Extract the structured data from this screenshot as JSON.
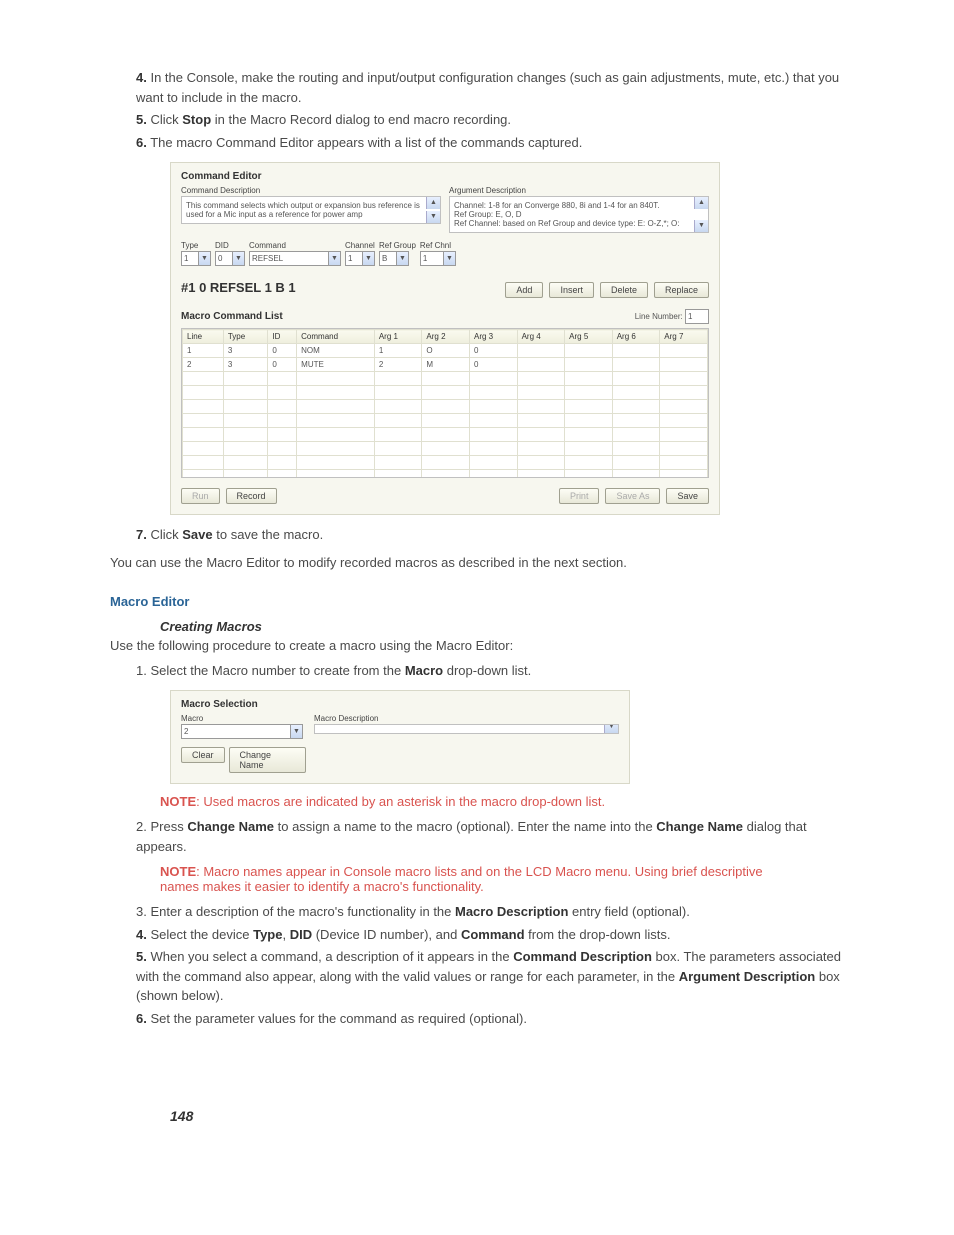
{
  "steps_top": {
    "s4": {
      "n": "4.",
      "text_a": "In the Console, make the routing and input/output configuration changes (such as gain adjustments, mute, etc.) that you want to include in the macro."
    },
    "s5": {
      "n": "5.",
      "pre": "Click ",
      "b": "Stop",
      "post": " in the Macro Record dialog to end macro recording."
    },
    "s6": {
      "n": "6.",
      "text": "The macro Command Editor appears with a list of the commands captured."
    }
  },
  "cmd_editor": {
    "title": "Command Editor",
    "cmd_desc_label": "Command Description",
    "arg_desc_label": "Argument Description",
    "cmd_desc_text": "This command selects which output or expansion bus reference is used for a Mic input as a reference for power amp",
    "arg_desc_text": "Channel: 1-8 for an Converge 880, 8i and 1-4 for an 840T.\nRef Group: E, O, D\nRef Channel: based on Ref Group and device type: E: O-Z,*; O:",
    "fields": {
      "type_label": "Type",
      "type_val": "1",
      "did_label": "DID",
      "did_val": "0",
      "command_label": "Command",
      "command_val": "REFSEL",
      "channel_label": "Channel",
      "channel_val": "1",
      "refgroup_label": "Ref Group",
      "refgroup_val": "B",
      "refchnl_label": "Ref Chnl",
      "refchnl_val": "1"
    },
    "big": "#1 0 REFSEL 1 B 1",
    "btn_add": "Add",
    "btn_insert": "Insert",
    "btn_delete": "Delete",
    "btn_replace": "Replace",
    "mcl_title": "Macro Command List",
    "line_number_label": "Line Number:",
    "line_number_val": "1",
    "cols": [
      "Line",
      "Type",
      "ID",
      "Command",
      "Arg 1",
      "Arg 2",
      "Arg 3",
      "Arg 4",
      "Arg 5",
      "Arg 6",
      "Arg 7"
    ],
    "rows": [
      [
        "1",
        "3",
        "0",
        "NOM",
        "1",
        "O",
        "0",
        "",
        "",
        "",
        ""
      ],
      [
        "2",
        "3",
        "0",
        "MUTE",
        "2",
        "M",
        "0",
        "",
        "",
        "",
        ""
      ]
    ],
    "btn_run": "Run",
    "btn_record": "Record",
    "btn_print": "Print",
    "btn_saveas": "Save As",
    "btn_save": "Save"
  },
  "step7": {
    "n": "7.",
    "pre": "Click ",
    "b": "Save",
    "post": " to save the macro."
  },
  "after7": "You can use the Macro Editor to modify recorded macros as described in the next section.",
  "section_heading": "Macro Editor",
  "subsection_heading": "Creating Macros",
  "intro_create": "Use the following procedure to create a macro using the Macro Editor:",
  "create_steps": {
    "s1": {
      "n": "1.",
      "pre": "Select the Macro number to create from the ",
      "b": "Macro",
      "post": " drop-down list."
    },
    "s2": {
      "n": "2.",
      "pre": "Press ",
      "b1": "Change Name",
      "mid": " to assign a name to the macro (optional). Enter the name into the ",
      "b2": "Change Name",
      "post": " dialog that appears."
    },
    "s3": {
      "n": "3.",
      "pre": "Enter a description of the macro's functionality in the ",
      "b": "Macro Description",
      "post": " entry field (optional)."
    },
    "s4": {
      "n": "4.",
      "pre": "Select the device ",
      "b1": "Type",
      "mid1": ", ",
      "b2": "DID",
      "mid2": " (Device ID number), and ",
      "b3": "Command",
      "post": " from the drop-down lists."
    },
    "s5": {
      "n": "5.",
      "pre": "When you select a command, a description of it appears in the ",
      "b1": "Command Description",
      "mid": " box. The parameters associated with the command also appear, along with the valid values or range for each parameter, in the ",
      "b2": "Argument Description",
      "post": " box (shown below)."
    },
    "s6": {
      "n": "6.",
      "text": "Set the parameter values for the command as required (optional)."
    }
  },
  "note1": {
    "label": "NOTE",
    "text": ": Used macros are indicated by an asterisk in the macro drop-down list."
  },
  "note2": {
    "label": "NOTE",
    "text": ": Macro names appear in Console macro lists and on the LCD Macro menu. Using brief descriptive names makes it easier to identify a macro's functionality."
  },
  "macro_sel": {
    "title": "Macro Selection",
    "macro_label": "Macro",
    "macro_val": "2",
    "desc_label": "Macro Description",
    "btn_clear": "Clear",
    "btn_change": "Change Name"
  },
  "page_number": "148"
}
